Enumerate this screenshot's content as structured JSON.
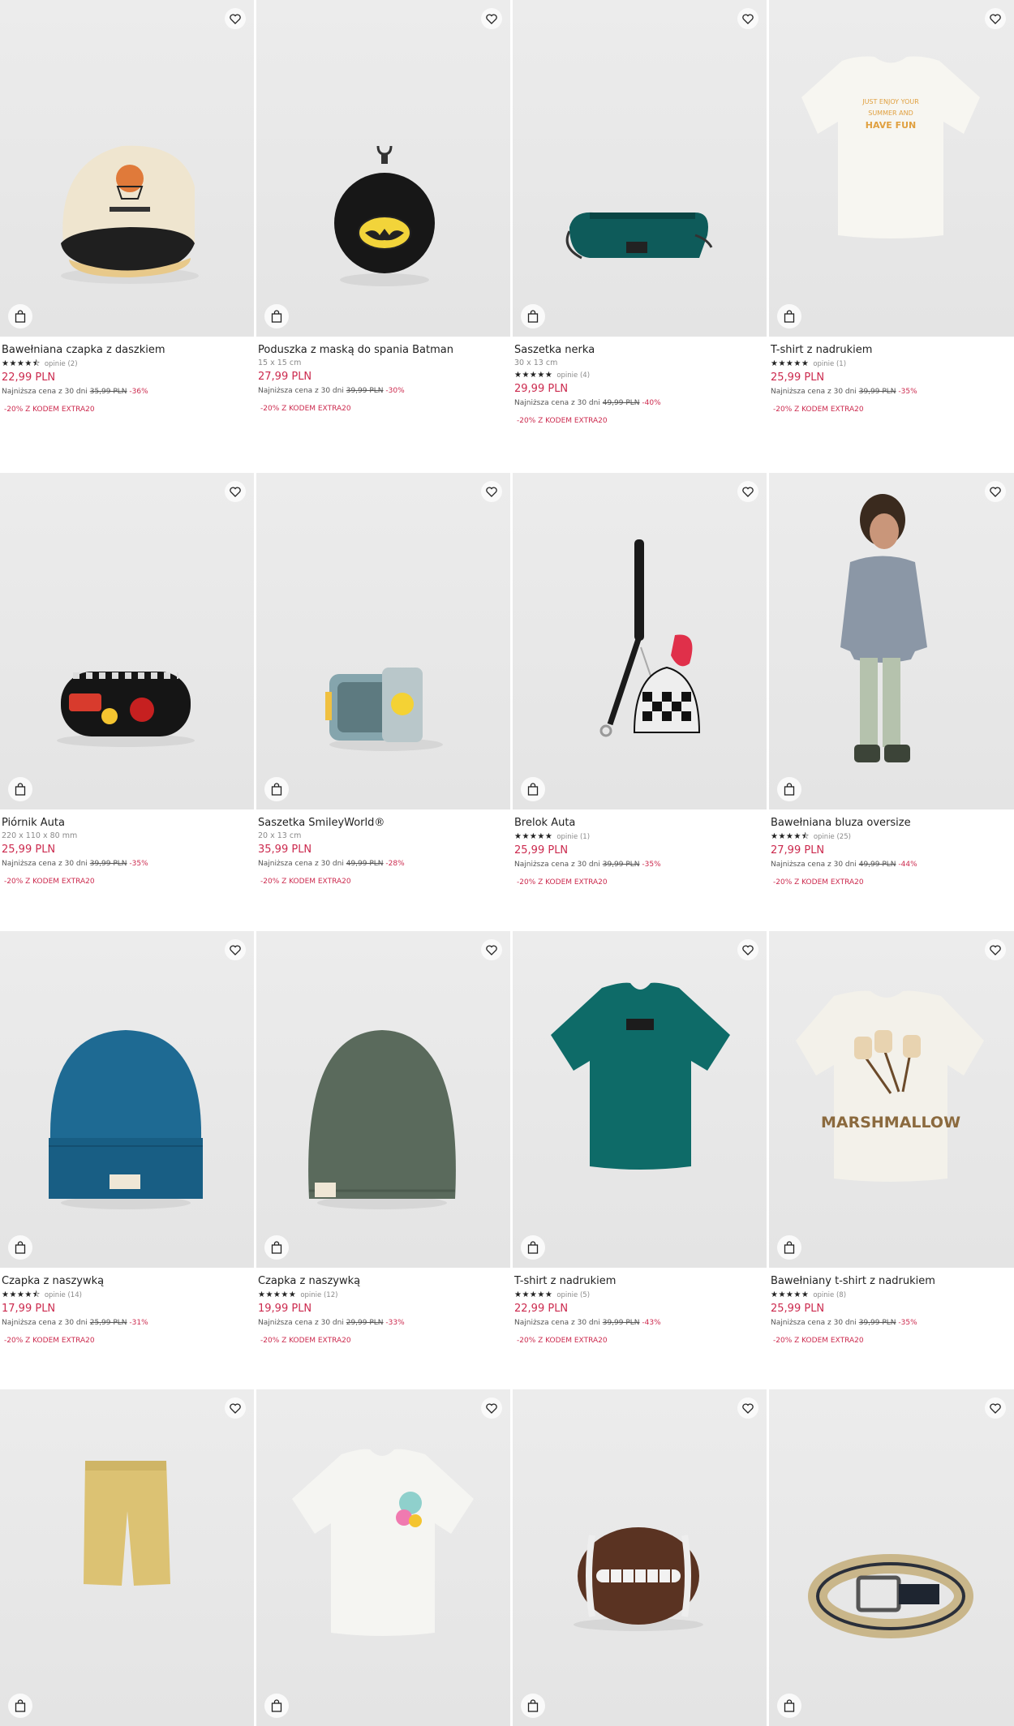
{
  "products": [
    {
      "title": "Bawełniana czapka z daszkiem",
      "dims": "",
      "stars": "★★★★⯪",
      "reviews": "opinie (2)",
      "price": "22,99 PLN",
      "lowest_label": "Najniższa cena z 30 dni",
      "old_price": "35,99 PLN",
      "discount": "-36%",
      "promo": "-20% Z KODEM EXTRA20",
      "image": "cap-icon"
    },
    {
      "title": "Poduszka z maską do spania Batman",
      "dims": "15 x 15 cm",
      "stars": "",
      "reviews": "",
      "price": "27,99 PLN",
      "lowest_label": "Najniższa cena z 30 dni",
      "old_price": "39,99 PLN",
      "discount": "-30%",
      "promo": "-20% Z KODEM EXTRA20",
      "image": "batman-pouch-icon"
    },
    {
      "title": "Saszetka nerka",
      "dims": "30 x 13 cm",
      "stars": "★★★★★",
      "reviews": "opinie (4)",
      "price": "29,99 PLN",
      "lowest_label": "Najniższa cena z 30 dni",
      "old_price": "49,99 PLN",
      "discount": "-40%",
      "promo": "-20% Z KODEM EXTRA20",
      "image": "waist-bag-icon"
    },
    {
      "title": "T-shirt z nadrukiem",
      "dims": "",
      "stars": "★★★★★",
      "reviews": "opinie (1)",
      "price": "25,99 PLN",
      "lowest_label": "Najniższa cena z 30 dni",
      "old_price": "39,99 PLN",
      "discount": "-35%",
      "promo": "-20% Z KODEM EXTRA20",
      "image": "tshirt-white-icon"
    },
    {
      "title": "Piórnik Auta",
      "dims": "220 x 110 x 80 mm",
      "stars": "",
      "reviews": "",
      "price": "25,99 PLN",
      "lowest_label": "Najniższa cena z 30 dni",
      "old_price": "39,99 PLN",
      "discount": "-35%",
      "promo": "-20% Z KODEM EXTRA20",
      "image": "pencil-case-icon"
    },
    {
      "title": "Saszetka SmileyWorld®",
      "dims": "20 x 13 cm",
      "stars": "",
      "reviews": "",
      "price": "35,99 PLN",
      "lowest_label": "Najniższa cena z 30 dni",
      "old_price": "49,99 PLN",
      "discount": "-28%",
      "promo": "-20% Z KODEM EXTRA20",
      "image": "smiley-pouch-icon"
    },
    {
      "title": "Brelok Auta",
      "dims": "",
      "stars": "★★★★★",
      "reviews": "opinie (1)",
      "price": "25,99 PLN",
      "lowest_label": "Najniższa cena z 30 dni",
      "old_price": "39,99 PLN",
      "discount": "-35%",
      "promo": "-20% Z KODEM EXTRA20",
      "image": "keychain-icon"
    },
    {
      "title": "Bawełniana bluza oversize",
      "dims": "",
      "stars": "★★★★⯪",
      "reviews": "opinie (25)",
      "price": "27,99 PLN",
      "lowest_label": "Najniższa cena z 30 dni",
      "old_price": "49,99 PLN",
      "discount": "-44%",
      "promo": "-20% Z KODEM EXTRA20",
      "image": "kid-hoodie-icon"
    },
    {
      "title": "Czapka z naszywką",
      "dims": "",
      "stars": "★★★★⯪",
      "reviews": "opinie (14)",
      "price": "17,99 PLN",
      "lowest_label": "Najniższa cena z 30 dni",
      "old_price": "25,99 PLN",
      "discount": "-31%",
      "promo": "-20% Z KODEM EXTRA20",
      "image": "beanie-blue-icon"
    },
    {
      "title": "Czapka z naszywką",
      "dims": "",
      "stars": "★★★★★",
      "reviews": "opinie (12)",
      "price": "19,99 PLN",
      "lowest_label": "Najniższa cena z 30 dni",
      "old_price": "29,99 PLN",
      "discount": "-33%",
      "promo": "-20% Z KODEM EXTRA20",
      "image": "beanie-green-icon"
    },
    {
      "title": "T-shirt z nadrukiem",
      "dims": "",
      "stars": "★★★★★",
      "reviews": "opinie (5)",
      "price": "22,99 PLN",
      "lowest_label": "Najniższa cena z 30 dni",
      "old_price": "39,99 PLN",
      "discount": "-43%",
      "promo": "-20% Z KODEM EXTRA20",
      "image": "tshirt-teal-icon"
    },
    {
      "title": "Bawełniany t-shirt z nadrukiem",
      "dims": "",
      "stars": "★★★★★",
      "reviews": "opinie (8)",
      "price": "25,99 PLN",
      "lowest_label": "Najniższa cena z 30 dni",
      "old_price": "39,99 PLN",
      "discount": "-35%",
      "promo": "-20% Z KODEM EXTRA20",
      "image": "tshirt-marshmallow-icon"
    },
    {
      "title": "",
      "dims": "",
      "stars": "",
      "reviews": "",
      "price": "",
      "lowest_label": "",
      "old_price": "",
      "discount": "",
      "promo": "",
      "image": "shorts-icon"
    },
    {
      "title": "",
      "dims": "",
      "stars": "",
      "reviews": "",
      "price": "",
      "lowest_label": "",
      "old_price": "",
      "discount": "",
      "promo": "",
      "image": "tshirt-smiley-icon"
    },
    {
      "title": "",
      "dims": "",
      "stars": "",
      "reviews": "",
      "price": "",
      "lowest_label": "",
      "old_price": "",
      "discount": "",
      "promo": "",
      "image": "football-icon"
    },
    {
      "title": "",
      "dims": "",
      "stars": "",
      "reviews": "",
      "price": "",
      "lowest_label": "",
      "old_price": "",
      "discount": "",
      "promo": "",
      "image": "belt-icon"
    }
  ],
  "icons": {
    "favorite": "heart-icon",
    "add_to_cart": "shopping-bag-icon"
  },
  "colors": {
    "price": "#cc2a4e",
    "background": "#e8e8e8"
  },
  "texts": {
    "shirt_print": "JUST ENJOY YOUR SUMMER AND HAVE FUN",
    "marshmallow": "MARSHMALLOW"
  }
}
